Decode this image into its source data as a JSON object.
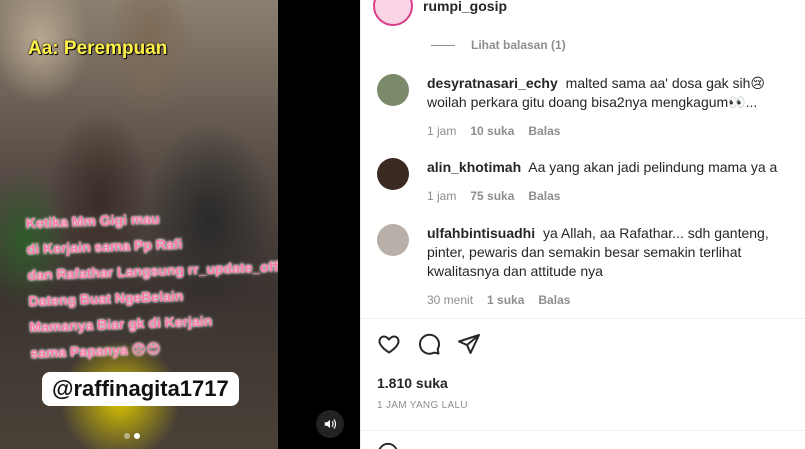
{
  "media": {
    "overlay_label": "Aa: Perempuan",
    "caption_lines": [
      "Ketika Mm Gigi mau",
      "di Kerjain sama Pp Rafi",
      "dan Rafathar Langsung rr_update_official",
      "Dateng Buat NgeBelain",
      "Mamanya Biar gk di Kerjain",
      "sama Papanya 😠😍"
    ],
    "handle": "@raffinagita1717",
    "carousel": {
      "count": 2,
      "active": 2
    }
  },
  "post_owner": {
    "username": "rumpi_gosip"
  },
  "view_replies": "Lihat balasan (1)",
  "comments": [
    {
      "username": "desyratnasari_echy",
      "text": "malted sama aa' dosa gak sih😢 woilah perkara gitu doang bisa2nya mengkagum👀...",
      "time": "1 jam",
      "likes": "10 suka",
      "reply": "Balas",
      "avatar_color": "#7a8a6a"
    },
    {
      "username": "alin_khotimah",
      "text": "Aa yang akan jadi pelindung mama ya a",
      "time": "1 jam",
      "likes": "75 suka",
      "reply": "Balas",
      "avatar_color": "#3a2a22"
    },
    {
      "username": "ulfahbintisuadhi",
      "text": "ya Allah, aa Rafathar... sdh ganteng, pinter, pewaris dan semakin besar semakin terlihat kwalitasnya dan attitude nya",
      "time": "30 menit",
      "likes": "1 suka",
      "reply": "Balas",
      "avatar_color": "#b8b0a8"
    }
  ],
  "actions": [
    "heart-icon",
    "comment-icon",
    "share-icon"
  ],
  "like_count": "1.810 suka",
  "post_time": "1 JAM YANG LALU"
}
